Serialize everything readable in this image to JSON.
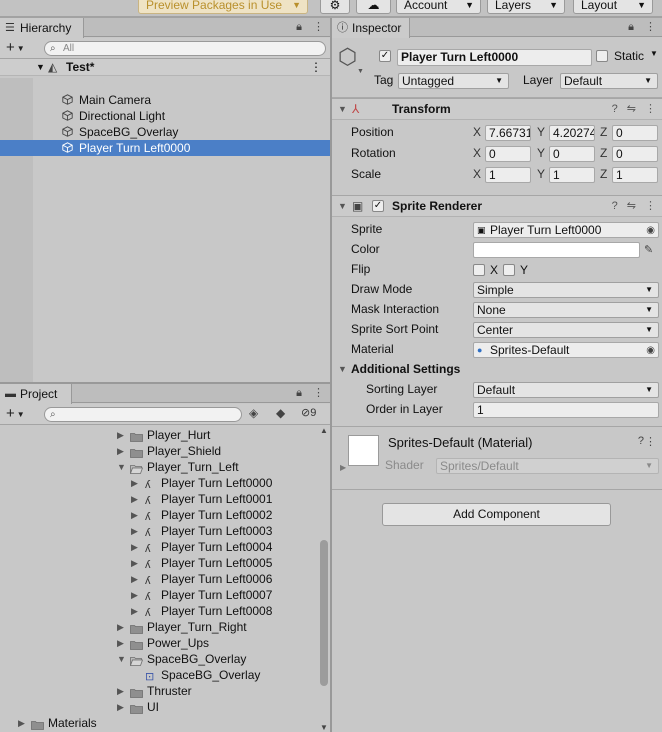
{
  "toolbar": {
    "preview_packages": "Preview Packages in Use",
    "account": "Account",
    "layers": "Layers",
    "layout": "Layout"
  },
  "hierarchy": {
    "tab_label": "Hierarchy",
    "search_placeholder": "All",
    "scene_name": "Test*",
    "items": [
      {
        "label": "Main Camera"
      },
      {
        "label": "Directional Light"
      },
      {
        "label": "SpaceBG_Overlay"
      },
      {
        "label": "Player Turn Left0000",
        "selected": true
      }
    ]
  },
  "project": {
    "tab_label": "Project",
    "hidden_count": "9",
    "items": [
      {
        "label": "Player_Hurt",
        "kind": "folder",
        "depth": 1,
        "expanded": false
      },
      {
        "label": "Player_Shield",
        "kind": "folder",
        "depth": 1,
        "expanded": false
      },
      {
        "label": "Player_Turn_Left",
        "kind": "folder",
        "depth": 1,
        "expanded": true
      },
      {
        "label": "Player Turn Left0000",
        "kind": "sprite",
        "depth": 2
      },
      {
        "label": "Player Turn Left0001",
        "kind": "sprite",
        "depth": 2
      },
      {
        "label": "Player Turn Left0002",
        "kind": "sprite",
        "depth": 2
      },
      {
        "label": "Player Turn Left0003",
        "kind": "sprite",
        "depth": 2
      },
      {
        "label": "Player Turn Left0004",
        "kind": "sprite",
        "depth": 2
      },
      {
        "label": "Player Turn Left0005",
        "kind": "sprite",
        "depth": 2
      },
      {
        "label": "Player Turn Left0006",
        "kind": "sprite",
        "depth": 2
      },
      {
        "label": "Player Turn Left0007",
        "kind": "sprite",
        "depth": 2
      },
      {
        "label": "Player Turn Left0008",
        "kind": "sprite",
        "depth": 2
      },
      {
        "label": "Player_Turn_Right",
        "kind": "folder",
        "depth": 1,
        "expanded": false
      },
      {
        "label": "Power_Ups",
        "kind": "folder",
        "depth": 1,
        "expanded": false
      },
      {
        "label": "SpaceBG_Overlay",
        "kind": "folder",
        "depth": 1,
        "expanded": true
      },
      {
        "label": "SpaceBG_Overlay",
        "kind": "prefab",
        "depth": 2
      },
      {
        "label": "Thruster",
        "kind": "folder",
        "depth": 1,
        "expanded": false
      },
      {
        "label": "UI",
        "kind": "folder",
        "depth": 1,
        "expanded": false
      },
      {
        "label": "Materials",
        "kind": "folder",
        "depth": 0,
        "expanded": false
      }
    ]
  },
  "inspector": {
    "tab_label": "Inspector",
    "object_name": "Player Turn Left0000",
    "static_label": "Static",
    "tag_label": "Tag",
    "tag_value": "Untagged",
    "layer_label": "Layer",
    "layer_value": "Default",
    "transform": {
      "title": "Transform",
      "rows": [
        {
          "label": "Position",
          "x": "7.66731",
          "y": "4.20274",
          "z": "0"
        },
        {
          "label": "Rotation",
          "x": "0",
          "y": "0",
          "z": "0"
        },
        {
          "label": "Scale",
          "x": "1",
          "y": "1",
          "z": "1"
        }
      ]
    },
    "sprite_renderer": {
      "title": "Sprite Renderer",
      "sprite_label": "Sprite",
      "sprite_value": "Player Turn Left0000",
      "color_label": "Color",
      "flip_label": "Flip",
      "flip_x": "X",
      "flip_y": "Y",
      "draw_mode_label": "Draw Mode",
      "draw_mode_value": "Simple",
      "mask_label": "Mask Interaction",
      "mask_value": "None",
      "sort_point_label": "Sprite Sort Point",
      "sort_point_value": "Center",
      "material_label": "Material",
      "material_value": "Sprites-Default",
      "additional_settings": "Additional Settings",
      "sorting_layer_label": "Sorting Layer",
      "sorting_layer_value": "Default",
      "order_label": "Order in Layer",
      "order_value": "1"
    },
    "material": {
      "title": "Sprites-Default (Material)",
      "shader_label": "Shader",
      "shader_value": "Sprites/Default"
    },
    "add_component": "Add Component"
  }
}
